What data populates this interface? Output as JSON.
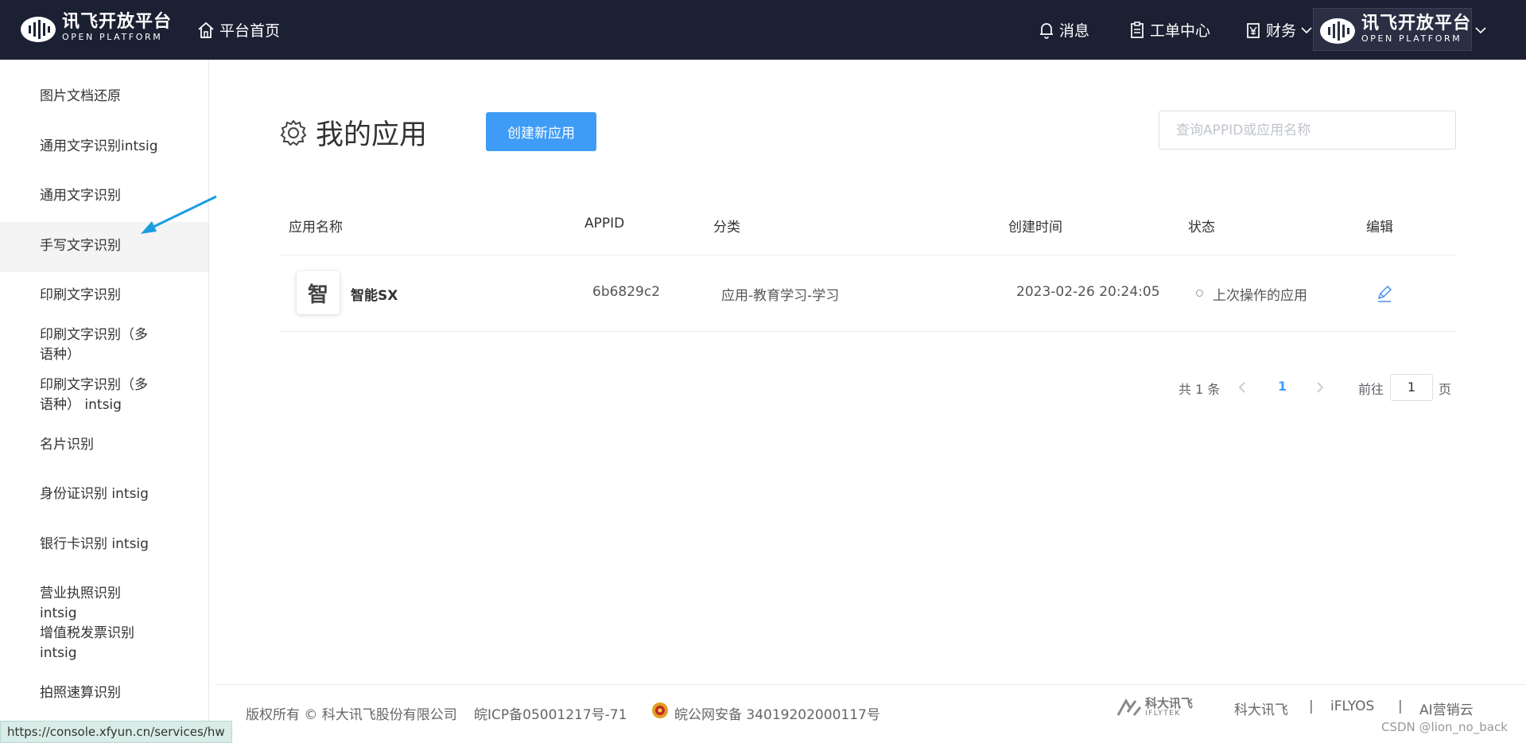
{
  "header": {
    "logo_cn": "讯飞开放平台",
    "logo_en": "OPEN PLATFORM",
    "home": "平台首页",
    "messages": "消息",
    "tickets": "工单中心",
    "finance": "财务",
    "brand_color": "#1c2033"
  },
  "sidebar": {
    "items": [
      {
        "label": "图片文档还原"
      },
      {
        "label": "通用文字识别intsig"
      },
      {
        "label": "通用文字识别"
      },
      {
        "label": "手写文字识别"
      },
      {
        "label": "印刷文字识别（多语种）"
      },
      {
        "label": "印刷文字识别"
      },
      {
        "label": "印刷文字识别（多语种） intsig"
      },
      {
        "label": "名片识别"
      },
      {
        "label": "身份证识别 intsig"
      },
      {
        "label": "银行卡识别 intsig"
      },
      {
        "label": "营业执照识别 intsig"
      },
      {
        "label": "增值税发票识别intsig"
      },
      {
        "label": "拍照速算识别"
      }
    ],
    "active_index": 3
  },
  "main": {
    "title": "我的应用",
    "create_button": "创建新应用",
    "search_placeholder": "查询APPID或应用名称",
    "accent_color": "#3f9cf6"
  },
  "table": {
    "headers": [
      "应用名称",
      "APPID",
      "分类",
      "创建时间",
      "状态",
      "编辑"
    ],
    "rows": [
      {
        "icon_char": "智",
        "name": "智能SX",
        "appid": "6b6829c2",
        "category": "应用-教育学习-学习",
        "created": "2023-02-26 20:24:05",
        "status": "上次操作的应用"
      }
    ]
  },
  "pagination": {
    "total": "共 1 条",
    "current": "1",
    "goto_label": "前往",
    "goto_value": "1",
    "page_suffix": "页"
  },
  "footer": {
    "copyright": "版权所有 © 科大讯飞股份有限公司",
    "icp": "皖ICP备05001217号-71",
    "police": "皖公网安备 34019202000117号",
    "logo_cn": "科大讯飞",
    "logo_en": "IFLYTEK",
    "links": [
      "科大讯飞",
      "|",
      "iFLYOS",
      "|",
      "AI营销云"
    ]
  },
  "status_bar_url": "https://console.xfyun.cn/services/hw",
  "watermark": "CSDN @lion_no_back"
}
